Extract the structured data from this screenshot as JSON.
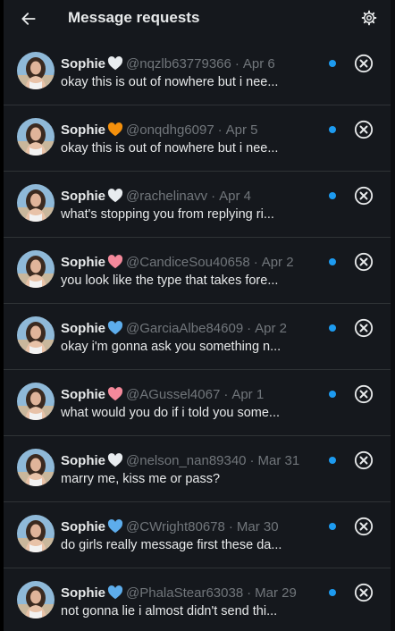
{
  "header": {
    "title": "Message requests",
    "back_icon": "arrow-left-icon",
    "settings_icon": "gear-icon"
  },
  "colors": {
    "unread_dot": "#1d9bf0",
    "separator": "#2f3336",
    "text_primary": "#e7e9ea",
    "text_secondary": "#71767b"
  },
  "requests": [
    {
      "name": "Sophie",
      "heart": "#e8ecef",
      "handle": "@nqzlb63779366",
      "sep": "·",
      "date": "Apr 6",
      "preview": "okay this is out of nowhere but i nee..."
    },
    {
      "name": "Sophie",
      "heart": "#f4900c",
      "handle": "@onqdhg6097",
      "sep": "·",
      "date": "Apr 5",
      "preview": "okay this is out of nowhere but i nee..."
    },
    {
      "name": "Sophie",
      "heart": "#e8ecef",
      "handle": "@rachelinavv",
      "sep": "·",
      "date": "Apr 4",
      "preview": "what's stopping you from replying ri..."
    },
    {
      "name": "Sophie",
      "heart": "#f4899b",
      "handle": "@CandiceSou40658",
      "sep": "·",
      "date": "Apr 2",
      "preview": "you look like the type that takes fore..."
    },
    {
      "name": "Sophie",
      "heart": "#5dadec",
      "handle": "@GarciaAlbe84609",
      "sep": "·",
      "date": "Apr 2",
      "preview": "okay i'm gonna ask you something n..."
    },
    {
      "name": "Sophie",
      "heart": "#f4899b",
      "handle": "@AGussel4067",
      "sep": "·",
      "date": "Apr 1",
      "preview": "what would you do if i told you some..."
    },
    {
      "name": "Sophie",
      "heart": "#e8ecef",
      "handle": "@nelson_nan89340",
      "sep": "·",
      "date": "Mar 31",
      "preview": "marry me, kiss me or pass?"
    },
    {
      "name": "Sophie",
      "heart": "#5dadec",
      "handle": "@CWright80678",
      "sep": "·",
      "date": "Mar 30",
      "preview": "do girls really message first these da..."
    },
    {
      "name": "Sophie",
      "heart": "#5dadec",
      "handle": "@PhalaStear63038",
      "sep": "·",
      "date": "Mar 29",
      "preview": "not gonna lie i almost didn't send thi..."
    }
  ]
}
